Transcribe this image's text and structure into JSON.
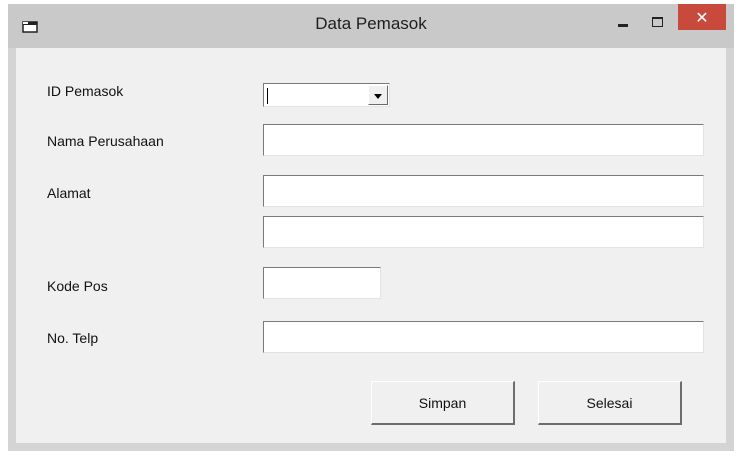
{
  "window": {
    "title": "Data Pemasok",
    "close_glyph": "✕"
  },
  "form": {
    "id_pemasok_label": "ID Pemasok",
    "id_pemasok_value": "",
    "nama_perusahaan_label": "Nama Perusahaan",
    "nama_perusahaan_value": "",
    "alamat_label": "Alamat",
    "alamat_line1_value": "",
    "alamat_line2_value": "",
    "kode_pos_label": "Kode Pos",
    "kode_pos_value": "",
    "no_telp_label": "No. Telp",
    "no_telp_value": ""
  },
  "buttons": {
    "simpan_label": "Simpan",
    "selesai_label": "Selesai"
  },
  "icons": {
    "app": "window-app-icon",
    "minimize": "minimize-icon",
    "maximize": "maximize-icon",
    "close": "close-icon",
    "dropdown": "chevron-down-icon"
  },
  "colors": {
    "titlebar": "#c9c9c9",
    "frame": "#d4d4d4",
    "client": "#f0f0f0",
    "close_button": "#c74a3c"
  }
}
